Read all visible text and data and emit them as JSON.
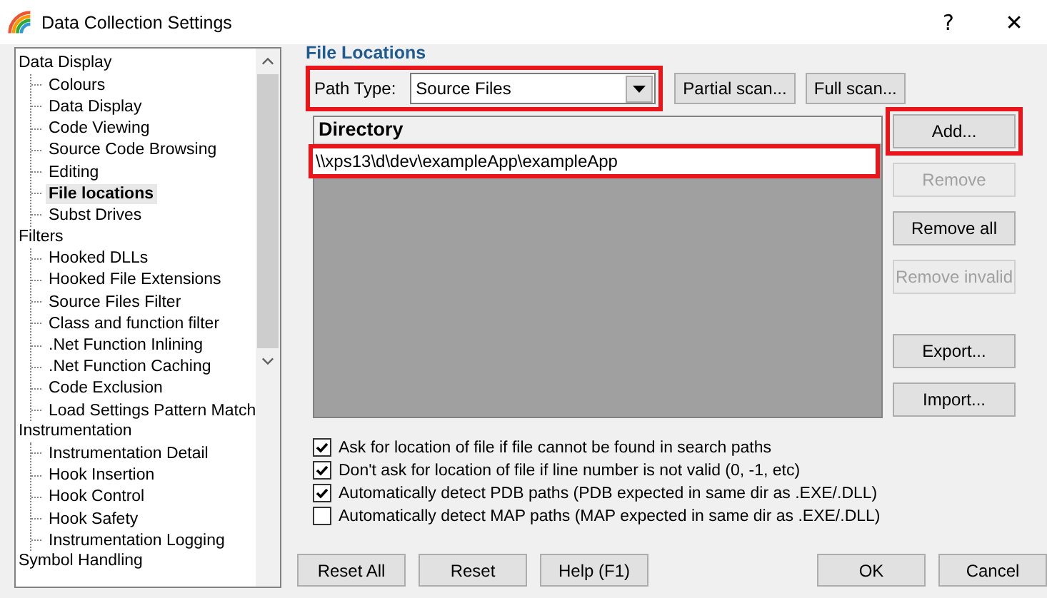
{
  "window": {
    "title": "Data Collection Settings",
    "help": "?",
    "close": "✕"
  },
  "tree": [
    {
      "label": "Data Display",
      "children": [
        {
          "label": "Colours",
          "selected": false
        },
        {
          "label": "Data Display",
          "selected": false
        },
        {
          "label": "Code Viewing",
          "selected": false
        },
        {
          "label": "Source Code Browsing",
          "selected": false
        },
        {
          "label": "Editing",
          "selected": false
        },
        {
          "label": "File locations",
          "selected": true
        },
        {
          "label": "Subst Drives",
          "selected": false
        }
      ]
    },
    {
      "label": "Filters",
      "children": [
        {
          "label": "Hooked DLLs",
          "selected": false
        },
        {
          "label": "Hooked File Extensions",
          "selected": false
        },
        {
          "label": "Source Files Filter",
          "selected": false
        },
        {
          "label": "Class and function filter",
          "selected": false
        },
        {
          "label": ".Net Function Inlining",
          "selected": false
        },
        {
          "label": ".Net Function Caching",
          "selected": false
        },
        {
          "label": "Code Exclusion",
          "selected": false
        },
        {
          "label": "Load Settings Pattern Match",
          "selected": false
        }
      ]
    },
    {
      "label": "Instrumentation",
      "children": [
        {
          "label": "Instrumentation Detail",
          "selected": false
        },
        {
          "label": "Hook Insertion",
          "selected": false
        },
        {
          "label": "Hook Control",
          "selected": false
        },
        {
          "label": "Hook Safety",
          "selected": false
        },
        {
          "label": "Instrumentation Logging",
          "selected": false
        }
      ]
    },
    {
      "label": "Symbol Handling"
    }
  ],
  "panel": {
    "heading": "File Locations",
    "path_type": {
      "label": "Path Type:",
      "value": "Source Files",
      "highlighted": true
    },
    "scan_buttons": [
      {
        "label": "Partial scan..."
      },
      {
        "label": "Full scan..."
      }
    ],
    "directory": {
      "header": "Directory",
      "rows": [
        {
          "text": "\\\\xps13\\d\\dev\\exampleApp\\exampleApp",
          "highlighted": true
        }
      ]
    },
    "side_buttons": [
      {
        "label": "Add...",
        "disabled": false,
        "highlighted": true
      },
      {
        "label": "Remove",
        "disabled": true,
        "highlighted": false
      },
      {
        "label": "Remove all",
        "disabled": false,
        "highlighted": false
      },
      {
        "label": "Remove invalid",
        "disabled": true,
        "highlighted": false
      }
    ],
    "file_buttons": [
      {
        "label": "Export..."
      },
      {
        "label": "Import..."
      }
    ],
    "options": [
      {
        "label": "Ask for location of file if file cannot be found in search paths",
        "checked": true
      },
      {
        "label": "Don't ask for location of file if line number is not valid (0, -1, etc)",
        "checked": true
      },
      {
        "label": "Automatically detect PDB paths (PDB expected in same dir as .EXE/.DLL)",
        "checked": true
      },
      {
        "label": "Automatically detect MAP paths (MAP expected in same dir as .EXE/.DLL)",
        "checked": false
      }
    ]
  },
  "footer": {
    "left": [
      "Reset All",
      "Reset",
      "Help (F1)"
    ],
    "right": [
      "OK",
      "Cancel"
    ]
  }
}
